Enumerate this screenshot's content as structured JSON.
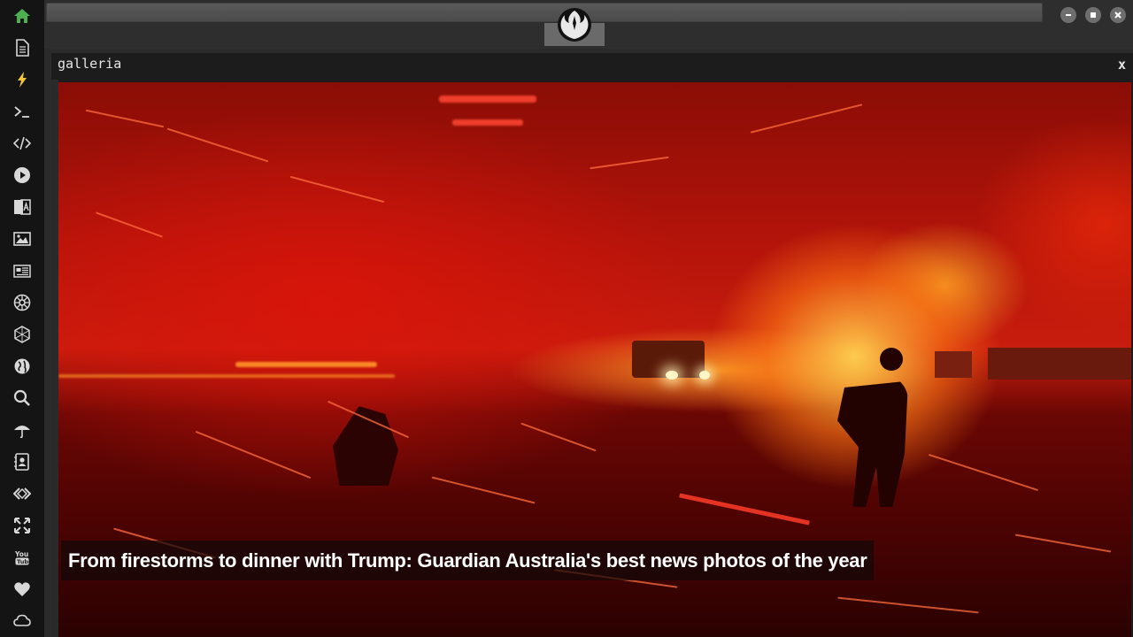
{
  "panel": {
    "title": "galleria",
    "close_label": "x"
  },
  "gallery": {
    "caption": "From firestorms to dinner with Trump: Guardian Australia's best news photos of the year"
  },
  "sidebar": {
    "items": [
      {
        "icon": "home-icon",
        "active": true
      },
      {
        "icon": "document-icon"
      },
      {
        "icon": "lightning-icon"
      },
      {
        "icon": "terminal-icon"
      },
      {
        "icon": "code-icon"
      },
      {
        "icon": "play-icon"
      },
      {
        "icon": "translate-icon"
      },
      {
        "icon": "image-icon"
      },
      {
        "icon": "newspaper-icon"
      },
      {
        "icon": "empire-icon"
      },
      {
        "icon": "hexagon-icon"
      },
      {
        "icon": "globe-icon"
      },
      {
        "icon": "search-icon"
      },
      {
        "icon": "umbrella-icon"
      },
      {
        "icon": "contacts-icon"
      },
      {
        "icon": "diamond-code-icon"
      },
      {
        "icon": "expand-icon"
      },
      {
        "icon": "youtube-icon"
      },
      {
        "icon": "heart-icon"
      },
      {
        "icon": "cloud-icon"
      }
    ]
  },
  "colors": {
    "active_icon": "#4caf50",
    "icon": "#d8d8d8",
    "sidebar_bg": "#141414",
    "panel_bg": "#1c1c1c"
  }
}
